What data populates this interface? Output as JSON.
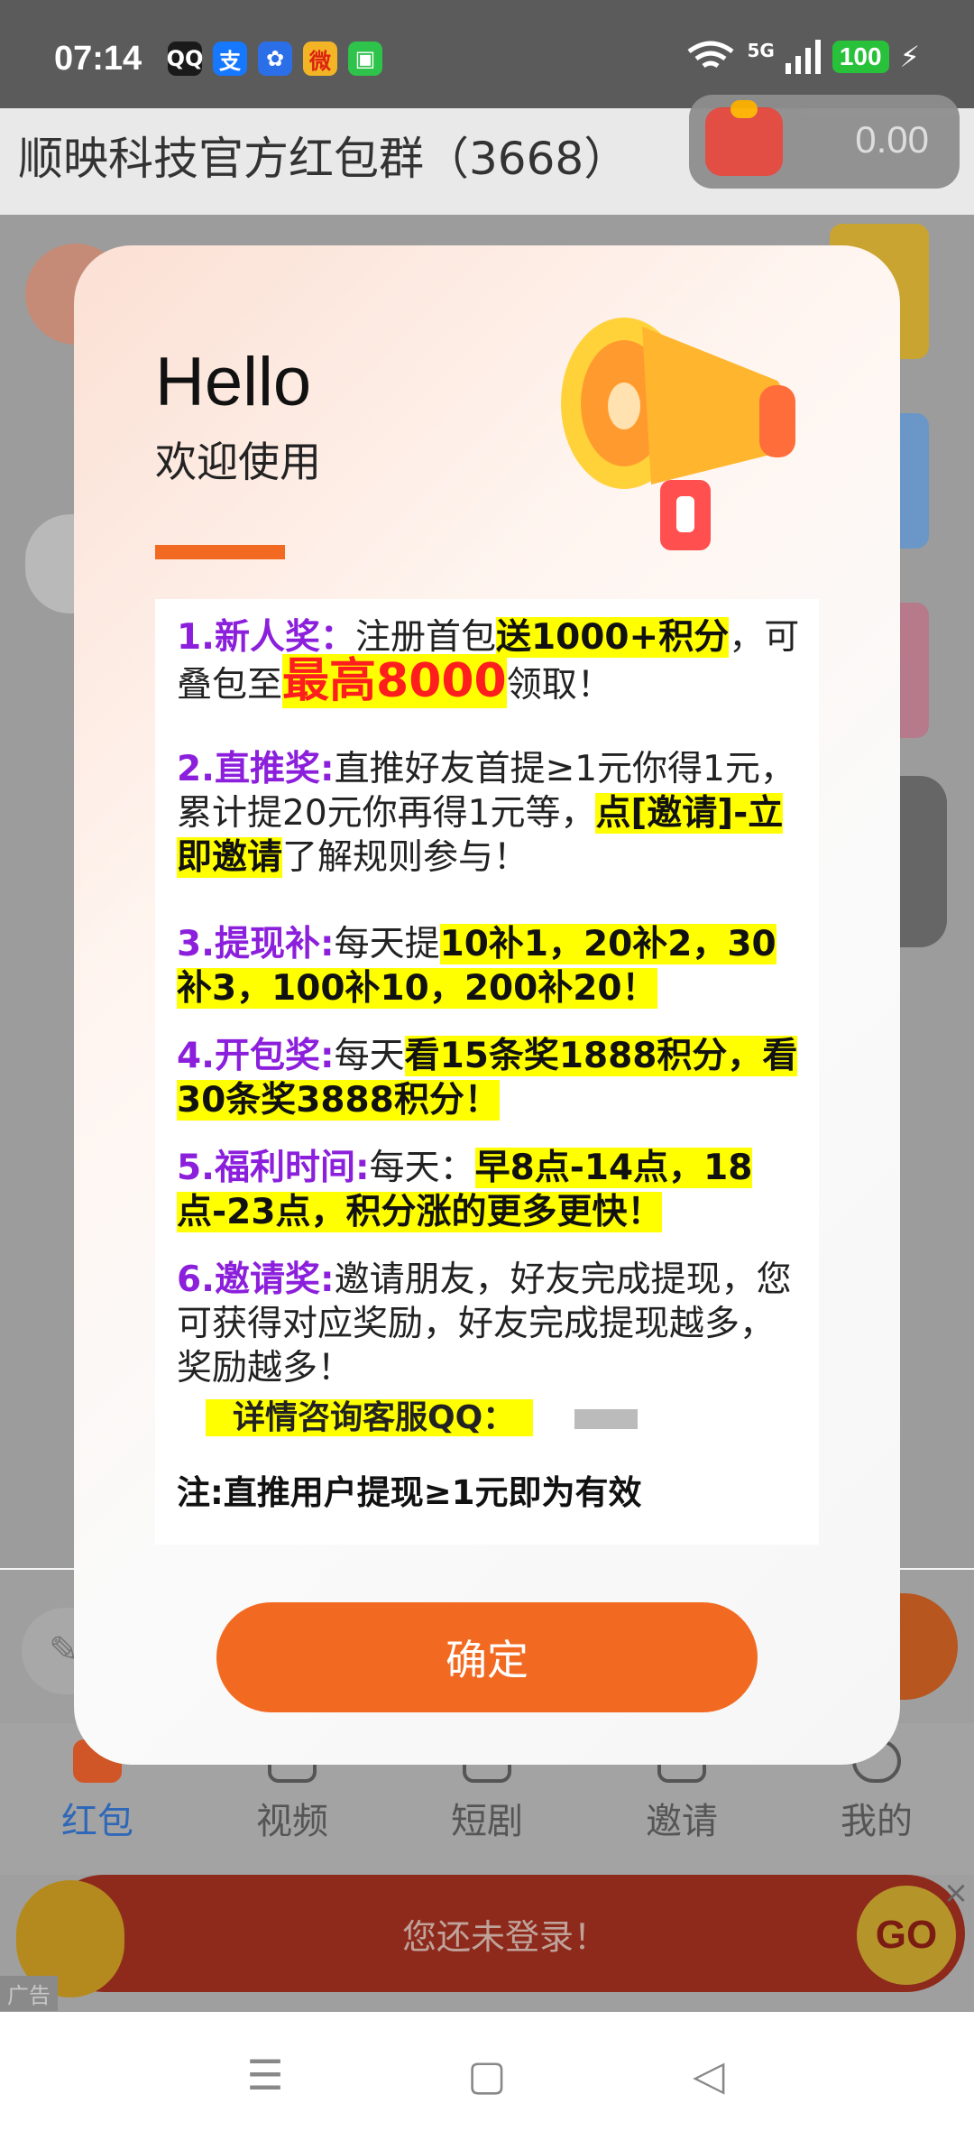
{
  "status_bar": {
    "time": "07:14",
    "apps": [
      "QQ",
      "支",
      "✿",
      "微",
      "▣"
    ],
    "network": "5G",
    "battery": "100"
  },
  "header": {
    "title": "顺映科技官方红包群（3668）",
    "balance": "0.00"
  },
  "modal": {
    "hello": "Hello",
    "welcome": "欢迎使用",
    "items": [
      {
        "key": "1.新人奖：",
        "text_a": "注册首包",
        "hl_a": "送1000+积分",
        "text_b": "，可叠包至",
        "big": "最高8000",
        "text_c": "领取！"
      },
      {
        "key": "2.直推奖:",
        "text_a": "直推好友首提≥1元你得1元，累计提20元你再得1元等，",
        "hl_a": "点[邀请]-立即邀请",
        "text_b": "了解规则参与！"
      },
      {
        "key": "3.提现补:",
        "text_a": "每天提",
        "hl_a": "10补1，20补2，30补3，100补10，200补20！"
      },
      {
        "key": "4.开包奖:",
        "text_a": "每天",
        "hl_a": "看15条奖1888积分，看30条奖3888积分！"
      },
      {
        "key": "5.福利时间:",
        "text_a": "每天：",
        "hl_a": "早8点-14点，18点-23点，积分涨的更多更快！"
      },
      {
        "key": "6.邀请奖:",
        "text_a": "邀请朋友，好友完成提现，您可获得对应奖励，好友完成提现越多，奖励越多！"
      }
    ],
    "qq_label": "详情咨询客服QQ：",
    "note": "注:直推用户提现≥1元即为有效",
    "confirm": "确定"
  },
  "tabs": [
    {
      "label": "红包",
      "icon": "red-packet-icon"
    },
    {
      "label": "视频",
      "icon": "video-icon"
    },
    {
      "label": "短剧",
      "icon": "short-drama-icon"
    },
    {
      "label": "邀请",
      "icon": "invite-icon"
    },
    {
      "label": "我的",
      "icon": "profile-icon"
    }
  ],
  "ad": {
    "text": "您还未登录！",
    "go": "GO",
    "label": "广告"
  },
  "colors": {
    "accent": "#f26a21",
    "key_purple": "#8b1fdc",
    "highlight": "#ffff00",
    "big_red": "#ff1e1e",
    "active_tab": "#2f68b8"
  }
}
